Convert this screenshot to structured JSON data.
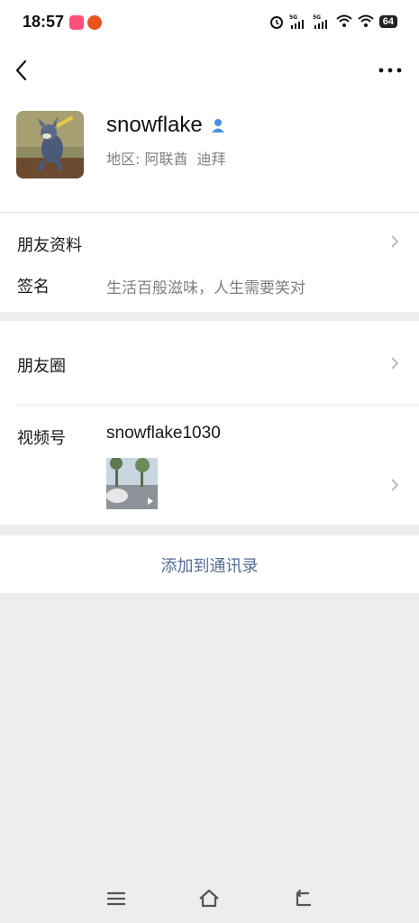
{
  "status": {
    "time": "18:57",
    "battery": "64"
  },
  "profile": {
    "name": "snowflake",
    "region_label": "地区:",
    "region_country": "阿联酋",
    "region_city": "迪拜"
  },
  "rows": {
    "friend_info": "朋友资料",
    "signature_label": "签名",
    "signature_value": "生活百般滋味，人生需要笑对",
    "moments": "朋友圈",
    "channels_label": "视频号",
    "channels_id": "snowflake1030"
  },
  "actions": {
    "add_contact": "添加到通讯录"
  },
  "colors": {
    "link": "#576b95",
    "verified": "#4a90e2",
    "background": "#ededed"
  }
}
